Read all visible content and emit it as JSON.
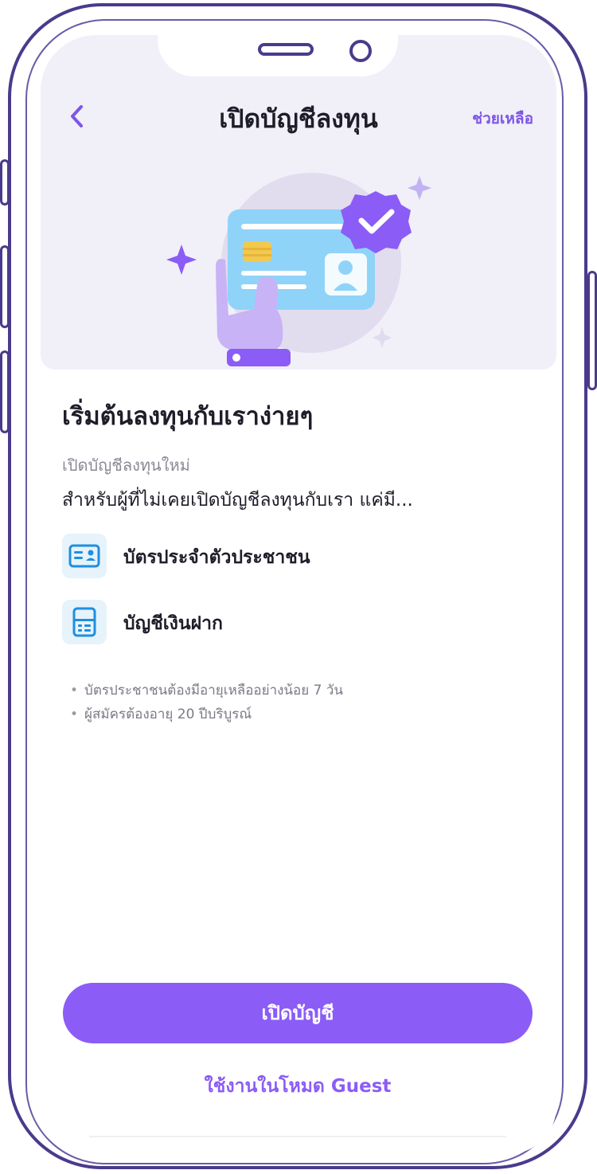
{
  "header": {
    "title": "เปิดบัญชีลงทุน",
    "help": "ช่วยเหลือ"
  },
  "main": {
    "heading": "เริ่มต้นลงทุนกับเราง่ายๆ",
    "subtitle": "เปิดบัญชีลงทุนใหม่",
    "description": "สำหรับผู้ที่ไม่เคยเปิดบัญชีลงทุนกับเรา แค่มี...",
    "requirements": [
      {
        "icon": "id-card-icon",
        "label": "บัตรประจำตัวประชาชน"
      },
      {
        "icon": "bank-book-icon",
        "label": "บัญชีเงินฝาก"
      }
    ],
    "notes": [
      "บัตรประชาชนต้องมีอายุเหลืออย่างน้อย 7 วัน",
      "ผู้สมัครต้องอายุ 20 ปีบริบูรณ์"
    ]
  },
  "actions": {
    "open_account": "เปิดบัญชี",
    "guest_mode": "ใช้งานในโหมด Guest"
  },
  "colors": {
    "accent": "#8b5cf6",
    "frame": "#4b3a8c",
    "hero_bg": "#f1eff8",
    "icon_bg": "#e6f3fb",
    "icon_blue": "#1f8fe0"
  }
}
